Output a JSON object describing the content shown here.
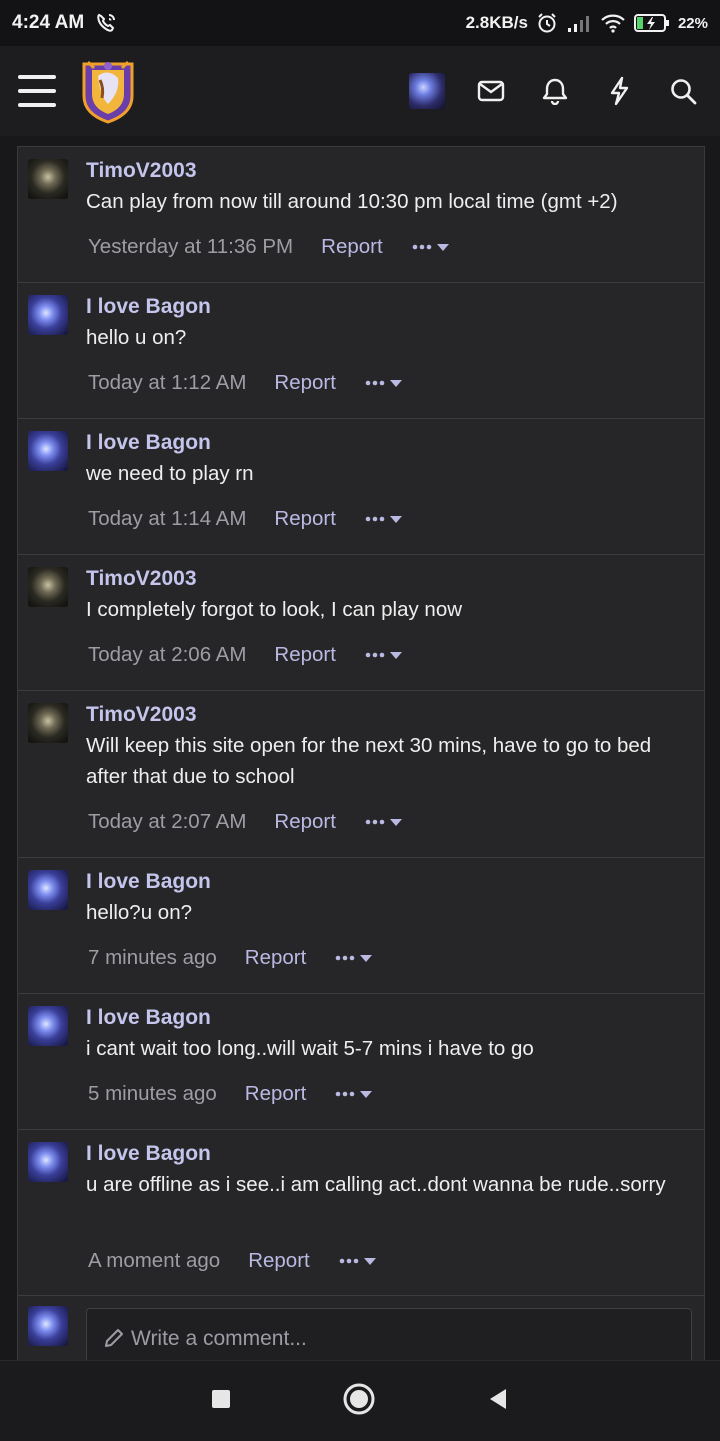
{
  "status": {
    "time": "4:24 AM",
    "speed": "2.8KB/s",
    "battery": "22%"
  },
  "header": {
    "menu_icon": "hamburger-icon",
    "logo_icon": "forum-crest-logo",
    "actions": [
      "user-avatar",
      "envelope-icon",
      "bell-icon",
      "bolt-icon",
      "search-icon"
    ]
  },
  "comments": [
    {
      "author": "TimoV2003",
      "avatar": "timo",
      "text": "Can play from now till around 10:30 pm local time (gmt +2)",
      "time": "Yesterday at 11:36 PM",
      "report": "Report"
    },
    {
      "author": "I love Bagon",
      "avatar": "bagon",
      "text": "hello u on?",
      "time": "Today at 1:12 AM",
      "report": "Report"
    },
    {
      "author": "I love Bagon",
      "avatar": "bagon",
      "text": "we need to play rn",
      "time": "Today at 1:14 AM",
      "report": "Report"
    },
    {
      "author": "TimoV2003",
      "avatar": "timo",
      "text": "I completely forgot to look, I can play now",
      "time": "Today at 2:06 AM",
      "report": "Report"
    },
    {
      "author": "TimoV2003",
      "avatar": "timo",
      "text": "Will keep this site open for the next 30 mins, have to go to bed after that due to school",
      "time": "Today at 2:07 AM",
      "report": "Report"
    },
    {
      "author": "I love Bagon",
      "avatar": "bagon",
      "text": "hello?u on?",
      "time": "7 minutes ago",
      "report": "Report"
    },
    {
      "author": "I love Bagon",
      "avatar": "bagon",
      "text": "i cant wait too long..will wait 5-7 mins i have to go",
      "time": "5 minutes ago",
      "report": "Report"
    },
    {
      "author": "I love Bagon",
      "avatar": "bagon",
      "text": "u are offline as i see..i am calling act..dont wanna be rude..sorry",
      "time": "A moment ago",
      "report": "Report"
    }
  ],
  "compose": {
    "placeholder": "Write a comment..."
  },
  "colors": {
    "background": "#262628",
    "author": "#c4c4ec",
    "link": "#b9b9e3",
    "muted": "#9d9da5"
  }
}
